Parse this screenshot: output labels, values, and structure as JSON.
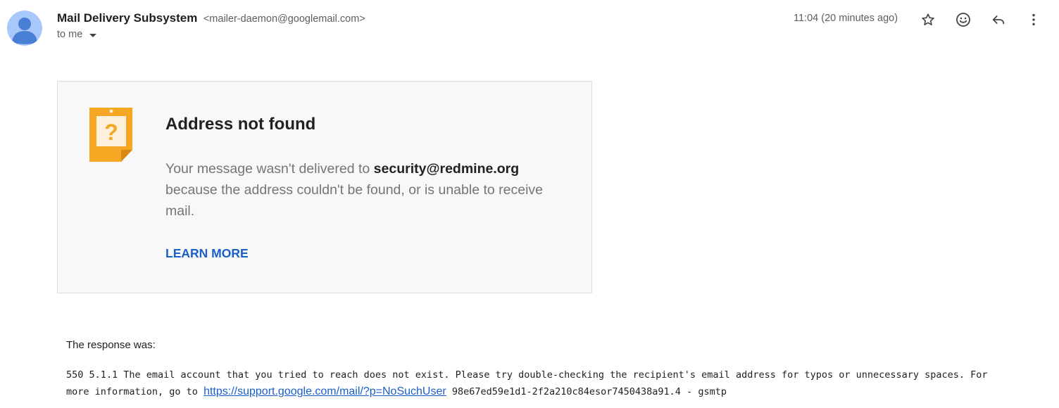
{
  "header": {
    "sender_name": "Mail Delivery Subsystem",
    "sender_email": "<mailer-daemon@googlemail.com>",
    "to_label": "to me",
    "timestamp": "11:04 (20 minutes ago)",
    "actions": [
      "star-icon",
      "emoji-reaction-icon",
      "reply-icon",
      "more-options-icon"
    ]
  },
  "card": {
    "icon": "note-question-icon",
    "icon_color": "#f5a623",
    "title": "Address not found",
    "body_prefix": "Your message wasn't delivered to ",
    "address": "security@redmine.org",
    "body_suffix": " because the address couldn't be found, or is unable to receive mail.",
    "learn_more": "LEARN MORE"
  },
  "response": {
    "label": "The response was:",
    "text_prefix": "550 5.1.1 The email account that you tried to reach does not exist. Please try double-checking the recipient's email address for typos or unnecessary spaces. For more information, go to ",
    "link": "https://support.google.com/mail/?p=NoSuchUser",
    "text_suffix": " 98e67ed59e1d1-2f2a210c84esor7450438a91.4 - gsmtp"
  },
  "colors": {
    "link": "#1a5fc8",
    "avatar_bg": "#a8c7fa",
    "avatar_fg": "#4a7fd6"
  }
}
